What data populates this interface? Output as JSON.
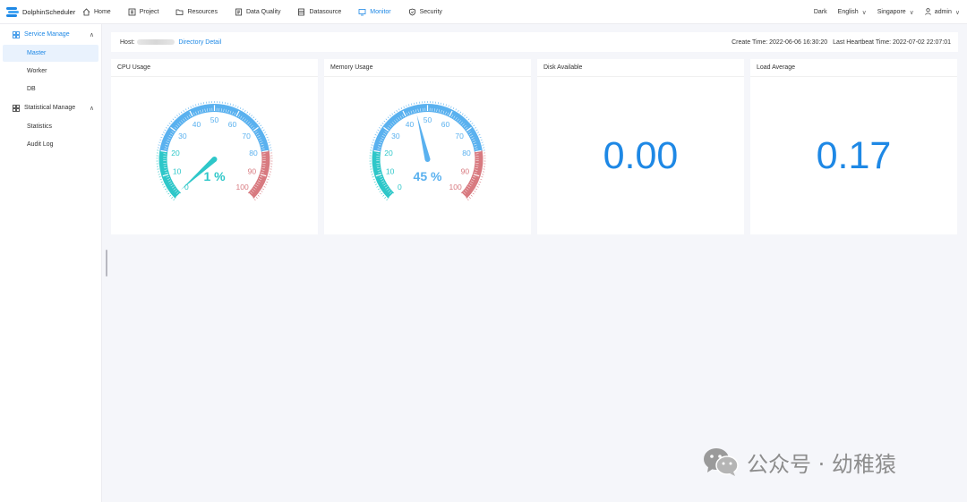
{
  "app": {
    "name": "DolphinScheduler"
  },
  "nav": {
    "items": [
      {
        "label": "Home",
        "icon": "home-icon"
      },
      {
        "label": "Project",
        "icon": "project-icon"
      },
      {
        "label": "Resources",
        "icon": "folder-icon"
      },
      {
        "label": "Data Quality",
        "icon": "data-quality-icon"
      },
      {
        "label": "Datasource",
        "icon": "datasource-icon"
      },
      {
        "label": "Monitor",
        "icon": "monitor-icon",
        "active": true
      },
      {
        "label": "Security",
        "icon": "shield-icon"
      }
    ]
  },
  "toolbar": {
    "theme": "Dark",
    "language": "English",
    "timezone": "Singapore",
    "user": "admin"
  },
  "sidebar": {
    "groups": [
      {
        "label": "Service Manage",
        "expanded": true,
        "items": [
          "Master",
          "Worker",
          "DB"
        ],
        "active_item": "Master"
      },
      {
        "label": "Statistical Manage",
        "expanded": true,
        "items": [
          "Statistics",
          "Audit Log"
        ]
      }
    ]
  },
  "host": {
    "label": "Host:",
    "directory_link": "Directory Detail",
    "create_time": "Create Time: 2022-06-06 16:30:20",
    "heartbeat_time": "Last Heartbeat Time: 2022-07-02 22:07:01"
  },
  "cards": {
    "cpu": {
      "title": "CPU Usage",
      "value": 1,
      "display": "1 %"
    },
    "memory": {
      "title": "Memory Usage",
      "value": 45,
      "display": "45 %"
    },
    "disk": {
      "title": "Disk Available",
      "value": "0.00"
    },
    "load": {
      "title": "Load Average",
      "value": "0.17"
    }
  },
  "gauge": {
    "ticks": [
      "0",
      "10",
      "20",
      "30",
      "40",
      "50",
      "60",
      "70",
      "80",
      "90",
      "100"
    ],
    "colors": {
      "low": "#2ec7c9",
      "mid": "#5ab1ef",
      "high": "#d87a80"
    }
  },
  "watermark": {
    "text": "公众号 · 幼稚猿"
  },
  "colors": {
    "accent": "#1e88e5",
    "background": "#f5f6fa"
  }
}
